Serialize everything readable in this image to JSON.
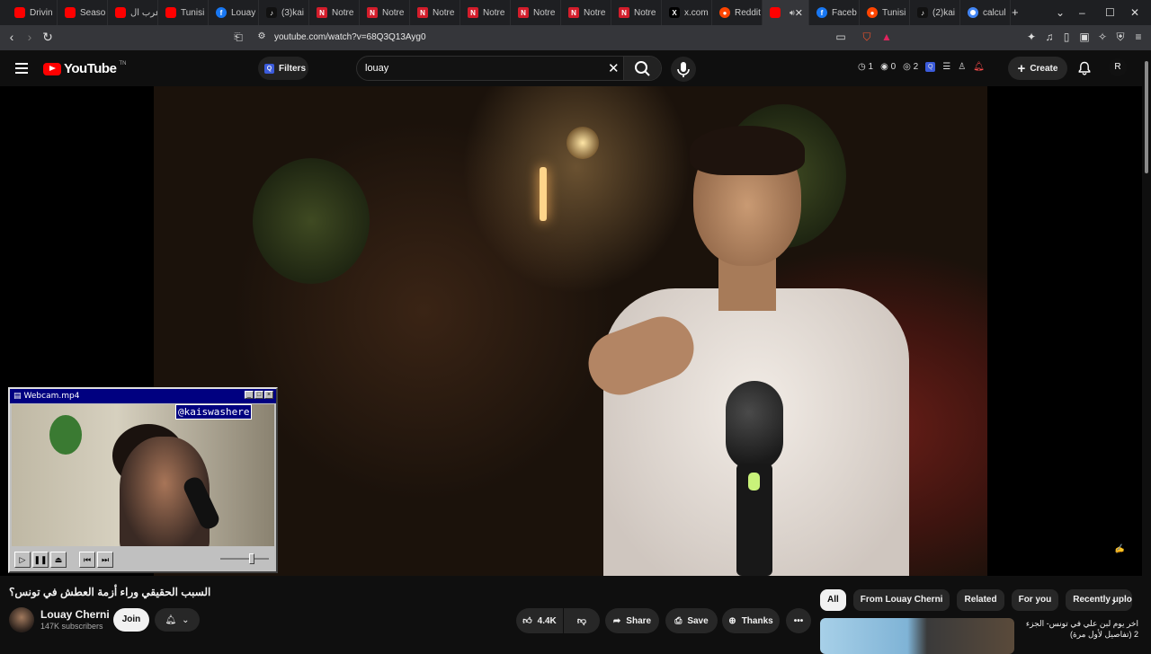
{
  "browser": {
    "tabs": [
      {
        "label": "Drivin",
        "icon": "youtube-icon"
      },
      {
        "label": "Seaso",
        "icon": "youtube-icon"
      },
      {
        "label": "عرب ال",
        "icon": "youtube-icon"
      },
      {
        "label": "Tunisi",
        "icon": "youtube-icon"
      },
      {
        "label": "Louay",
        "icon": "facebook-icon"
      },
      {
        "label": "(3)kai",
        "icon": "tiktok-icon"
      },
      {
        "label": "Notre",
        "icon": "notre-icon"
      },
      {
        "label": "Notre",
        "icon": "notre-icon"
      },
      {
        "label": "Notre",
        "icon": "notre-icon"
      },
      {
        "label": "Notre",
        "icon": "notre-icon"
      },
      {
        "label": "Notre",
        "icon": "notre-icon"
      },
      {
        "label": "Notre",
        "icon": "notre-icon"
      },
      {
        "label": "Notre",
        "icon": "notre-icon"
      },
      {
        "label": "x.com",
        "icon": "x-icon"
      },
      {
        "label": "Reddit",
        "icon": "reddit-icon"
      },
      {
        "label": "",
        "icon": "youtube-icon",
        "active": true
      },
      {
        "label": "Faceb",
        "icon": "facebook-icon"
      },
      {
        "label": "Tunisi",
        "icon": "reddit-icon"
      },
      {
        "label": "(2)kai",
        "icon": "tiktok-icon"
      },
      {
        "label": "calcul",
        "icon": "google-icon"
      }
    ],
    "url": "youtube.com/watch?v=68Q3Q13Ayg0"
  },
  "youtube": {
    "logo_text": "YouTube",
    "logo_sup": "TN",
    "filters_label": "Filters",
    "search_value": "louay",
    "counters": [
      "1",
      "0",
      "2"
    ],
    "create_label": "Create",
    "avatar_letter": "R"
  },
  "miniplayer": {
    "title": "Webcam.mp4",
    "handle": "@kaiswashere"
  },
  "video": {
    "title": "السبب الحقيقي وراء أزمة العطش في تونس؟",
    "channel": "Louay Cherni",
    "subscribers": "147K subscribers",
    "join_label": "Join",
    "likes": "4.4K",
    "share_label": "Share",
    "save_label": "Save",
    "thanks_label": "Thanks"
  },
  "related": {
    "chips": [
      "All",
      "From Louay Cherni",
      "Related",
      "For you",
      "Recently uploa"
    ],
    "first_title": "اخر يوم لبن علي في تونس- الجزء 2 (تفاصيل لأول مرة)"
  }
}
